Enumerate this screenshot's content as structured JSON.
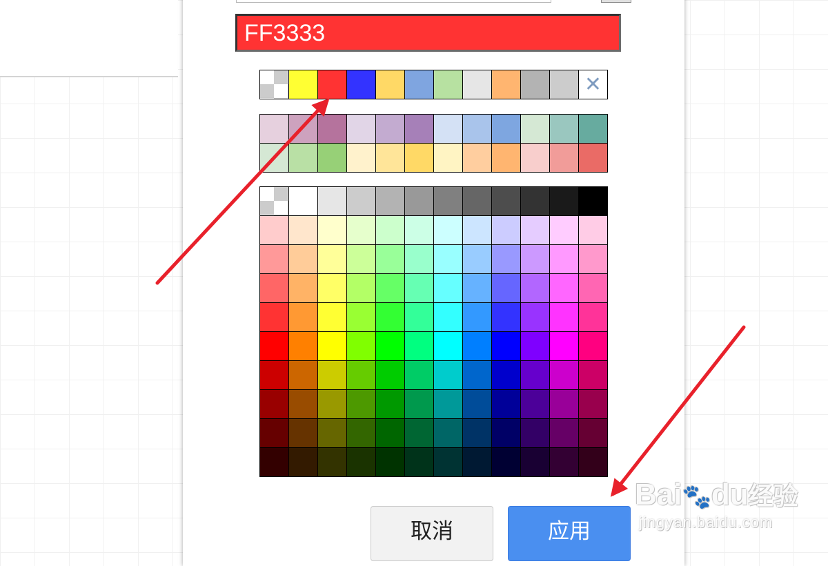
{
  "hex_field": {
    "value": "FF3333",
    "background": "#FF3333"
  },
  "recent_colors": [
    "transparent",
    "#FFFF33",
    "#FF3333",
    "#3333FF",
    "#FFD966",
    "#7FA5E0",
    "#B7E1A1",
    "#E6E6E6",
    "#FFB570",
    "#B3B3B3",
    "#CCCCCC",
    "none"
  ],
  "preset_colors": [
    [
      "#E6D0DE",
      "#CDA2BE",
      "#B5739D",
      "#E1D5E7",
      "#C3ABD0",
      "#A680B8",
      "#D4E1F5",
      "#A9C4EB",
      "#7EA6E0",
      "#D5E8D4",
      "#9AC7BF",
      "#67AB9F"
    ],
    [
      "#D5E8D4",
      "#B9E0A5",
      "#97D077",
      "#FFF2CC",
      "#FFE599",
      "#FFD966",
      "#FFF4C3",
      "#FFCE9F",
      "#FFB570",
      "#F8CECC",
      "#F19C99",
      "#EA6B66"
    ]
  ],
  "palette_colors": [
    [
      "transparent",
      "#FFFFFF",
      "#E6E6E6",
      "#CCCCCC",
      "#B3B3B3",
      "#999999",
      "#808080",
      "#666666",
      "#4D4D4D",
      "#333333",
      "#1A1A1A",
      "#000000"
    ],
    [
      "#FFCCCC",
      "#FFE6CC",
      "#FFFFCC",
      "#E6FFCC",
      "#CCFFCC",
      "#CCFFE6",
      "#CCFFFF",
      "#CCE5FF",
      "#CCCCFF",
      "#E5CCFF",
      "#FFCCFF",
      "#FFCCE6"
    ],
    [
      "#FF9999",
      "#FFCC99",
      "#FFFF99",
      "#CCFF99",
      "#99FF99",
      "#99FFCC",
      "#99FFFF",
      "#99CCFF",
      "#9999FF",
      "#CC99FF",
      "#FF99FF",
      "#FF99CC"
    ],
    [
      "#FF6666",
      "#FFB366",
      "#FFFF66",
      "#B3FF66",
      "#66FF66",
      "#66FFB3",
      "#66FFFF",
      "#66B2FF",
      "#6666FF",
      "#B266FF",
      "#FF66FF",
      "#FF66B3"
    ],
    [
      "#FF3333",
      "#FF9933",
      "#FFFF33",
      "#99FF33",
      "#33FF33",
      "#33FF99",
      "#33FFFF",
      "#3399FF",
      "#3333FF",
      "#9933FF",
      "#FF33FF",
      "#FF3399"
    ],
    [
      "#FF0000",
      "#FF8000",
      "#FFFF00",
      "#80FF00",
      "#00FF00",
      "#00FF80",
      "#00FFFF",
      "#007FFF",
      "#0000FF",
      "#7F00FF",
      "#FF00FF",
      "#FF0080"
    ],
    [
      "#CC0000",
      "#CC6600",
      "#CCCC00",
      "#66CC00",
      "#00CC00",
      "#00CC66",
      "#00CCCC",
      "#0066CC",
      "#0000CC",
      "#6600CC",
      "#CC00CC",
      "#CC0066"
    ],
    [
      "#990000",
      "#994C00",
      "#999900",
      "#4D9900",
      "#009900",
      "#00994D",
      "#009999",
      "#004C99",
      "#000099",
      "#4C0099",
      "#990099",
      "#99004D"
    ],
    [
      "#660000",
      "#663300",
      "#666600",
      "#336600",
      "#006600",
      "#006633",
      "#006666",
      "#003366",
      "#000066",
      "#330066",
      "#660066",
      "#660033"
    ],
    [
      "#330000",
      "#331A00",
      "#333300",
      "#1A3300",
      "#003300",
      "#00331A",
      "#003333",
      "#001933",
      "#000033",
      "#190033",
      "#330033",
      "#33001A"
    ]
  ],
  "buttons": {
    "cancel": "取消",
    "apply": "应用"
  },
  "watermark": {
    "logo_latin_1": "Bai",
    "logo_paw": "🐾",
    "logo_latin_2": "du",
    "logo_cn": "经验",
    "url": "jingyan.baidu.com"
  },
  "annotation_color": "#E8212B"
}
